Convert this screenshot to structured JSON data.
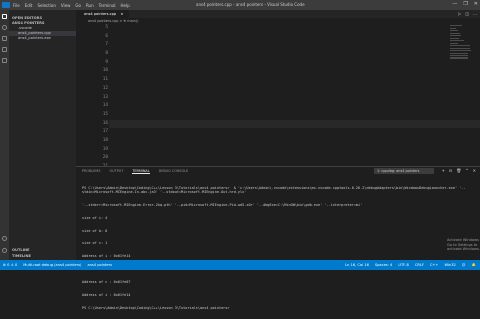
{
  "window": {
    "title": "ans4 pointers.cpp - ans4 pointers - Visual Studio Code",
    "menu": [
      "File",
      "Edit",
      "Selection",
      "View",
      "Go",
      "Run",
      "Terminal",
      "Help"
    ],
    "controls": [
      "—",
      "❐",
      "✕"
    ]
  },
  "sidebar": {
    "section_open_editors": "OPEN EDITORS",
    "section_folder": "ANS4 POINTERS",
    "items": [
      ".vscode",
      "ans4_pointers.cpp",
      "ans4_pointers.exe"
    ],
    "outline": "OUTLINE",
    "timeline": "TIMELINE"
  },
  "editor": {
    "tab_label": "ans4 pointers.cpp",
    "tab_close": "×",
    "breadcrumb": "ans4 pointers.cpp > ⊕ main()",
    "tab_actions": [
      "▷",
      "◫",
      "…"
    ],
    "line_numbers": [
      "5",
      "6",
      "7",
      "8",
      "9",
      "10",
      "11",
      "12",
      "13",
      "14",
      "15",
      "16",
      "17",
      "18",
      "19",
      "20",
      "21",
      "22",
      "23"
    ]
  },
  "panel": {
    "tabs": [
      "PROBLEMS",
      "OUTPUT",
      "TERMINAL",
      "DEBUG CONSOLE"
    ],
    "active_tab": "TERMINAL",
    "shell": "1: cppdbg: ans4 pointers",
    "actions": [
      "+",
      "⊟",
      "🗑",
      "^",
      "✕"
    ],
    "terminal_lines": [
      "PS C:\\Users\\Admin\\Desktop\\Coding\\C++\\Lesson 3\\Tutorials\\ans4 pointers>  & 'c:\\Users\\Admin\\.vscode\\extensions\\ms-vscode.cpptools-0.26.2\\debugAdapters\\bin\\WindowsDebugLauncher.exe' '--stdin=Microsoft-MIEngine-In-abc.ja3' '--stdout=Microsoft-MIEngine-Out-hrd.ylx'",
      "'--stderr=Microsoft-MIEngine-Error-2kq.pth' '--pid=Microsoft-MIEngine-Pid-wd5.x0r' '--dbgExe=C:\\MinGW\\bin\\gdb.exe' '--interpreter=mi'",
      "size of i: 4",
      "size of b: 8",
      "size of c: 1",
      "Address of i : 0x61fe14",
      "Address of b : 0x61fe08",
      "Address of c : 0x61fe07",
      "Address of i : 0x61fe14",
      "PS C:\\Users\\Admin\\Desktop\\Coding\\C++\\Lesson 3\\Tutorials\\ans4 pointers> "
    ],
    "watermark_title": "Activate Windows",
    "watermark_sub": "Go to Settings to activate Windows."
  },
  "statusbar": {
    "left": [
      "⊗ 0  ⚠ 0",
      "Multi-root debug (ans4 pointers)",
      "ans4 pointers"
    ],
    "right": [
      "Ln 16, Col 16",
      "Spaces: 4",
      "UTF-8",
      "CRLF",
      "C++",
      "Win32",
      "☺",
      "🔔"
    ]
  },
  "colors": {
    "statusbar": "#007acc",
    "editor_bg": "#1e1e1e",
    "sidebar_bg": "#252526",
    "activitybar_bg": "#333333"
  }
}
